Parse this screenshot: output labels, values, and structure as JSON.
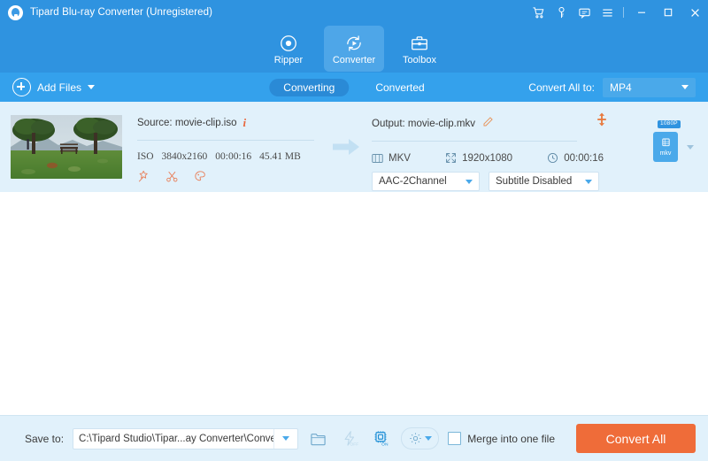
{
  "window": {
    "title": "Tipard Blu-ray Converter (Unregistered)",
    "logo_icon": "disc-logo-icon",
    "icons": [
      {
        "name": "cart-icon",
        "label": "Buy"
      },
      {
        "name": "key-icon",
        "label": "Register"
      },
      {
        "name": "feedback-icon",
        "label": "Feedback"
      },
      {
        "name": "menu-icon",
        "label": "Menu"
      }
    ],
    "controls": [
      {
        "name": "minimize-button",
        "label": "Minimize"
      },
      {
        "name": "maximize-button",
        "label": "Maximize"
      },
      {
        "name": "close-button",
        "label": "Close"
      }
    ],
    "accent_color": "#2f93e0",
    "titlebar_color": "#2f93e0"
  },
  "nav": {
    "tabs": [
      {
        "label": "Ripper",
        "icon": "disc-icon",
        "active": false
      },
      {
        "label": "Converter",
        "icon": "convert-circle-icon",
        "active": true
      },
      {
        "label": "Toolbox",
        "icon": "toolbox-icon",
        "active": false
      }
    ]
  },
  "toolbar": {
    "add_files_label": "Add Files",
    "add_files_icon": "plus-circle-icon",
    "segments": [
      {
        "label": "Converting",
        "active": true
      },
      {
        "label": "Converted",
        "active": false
      }
    ],
    "convert_all_to_label": "Convert All to:",
    "convert_all_to_value": "MP4"
  },
  "file": {
    "thumbnail_alt": "park-scene-thumbnail",
    "source": {
      "label": "Source: movie-clip.iso",
      "info_icon": "info-icon",
      "container": "ISO",
      "resolution": "3840x2160",
      "duration": "00:00:16",
      "size": "45.41 MB",
      "tools": [
        {
          "name": "magic-wand-icon",
          "label": "Edit"
        },
        {
          "name": "scissors-icon",
          "label": "Cut"
        },
        {
          "name": "palette-icon",
          "label": "Effects"
        }
      ]
    },
    "output": {
      "label": "Output: movie-clip.mkv",
      "edit_icon": "pencil-icon",
      "merge_icon": "merge-arrows-icon",
      "container": "MKV",
      "resolution": "1920x1080",
      "duration": "00:00:16",
      "audio_track": "AAC-2Channel",
      "subtitle_track": "Subtitle Disabled"
    },
    "format_badge": {
      "resolution_tag": "1080P",
      "extension": "mkv"
    }
  },
  "bottom": {
    "save_to_label": "Save to:",
    "save_to_path": "C:\\Tipard Studio\\Tipar...ay Converter\\Converted",
    "open_folder_icon": "open-folder-icon",
    "hw_accel": {
      "icon": "lightning-icon",
      "state": "OFF",
      "enabled": false
    },
    "gpu_accel": {
      "icon": "cpu-chip-icon",
      "state": "ON",
      "enabled": true
    },
    "settings_icon": "gear-icon",
    "merge_label": "Merge into one file",
    "merge_checked": false,
    "convert_button": "Convert All",
    "convert_button_color": "#ef6c39"
  }
}
